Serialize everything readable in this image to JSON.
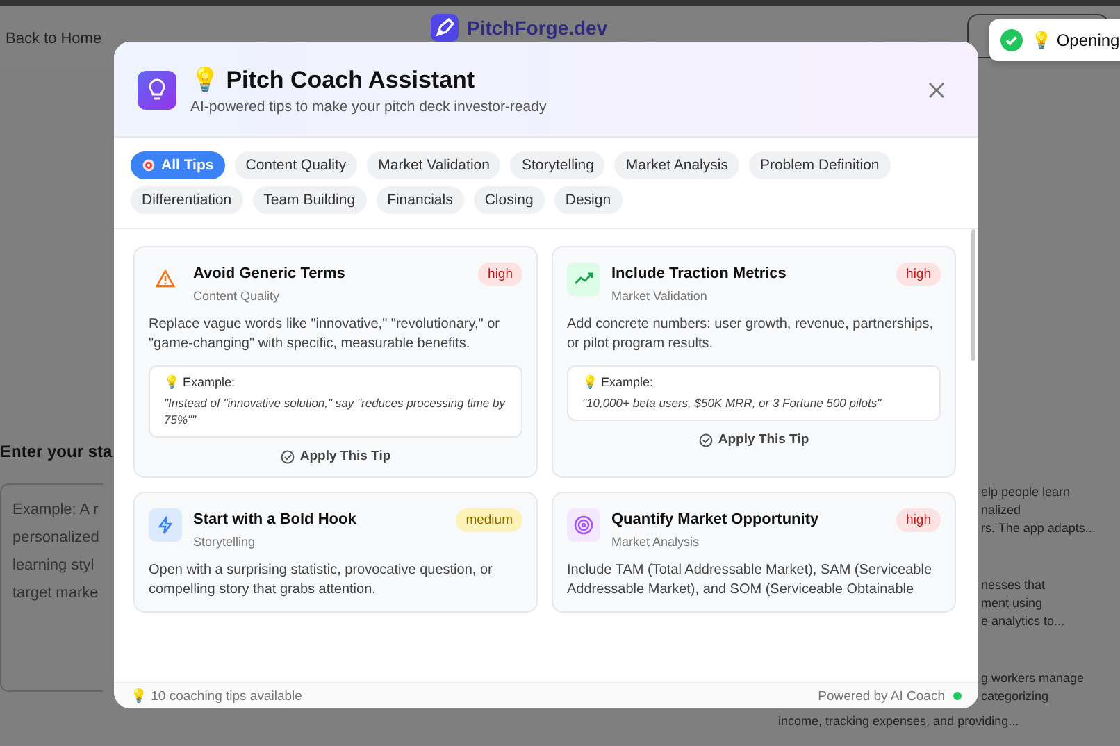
{
  "page": {
    "back_link": "Back to Home",
    "logo_text": "PitchForge.dev",
    "prompt_label": "Enter your sta",
    "textarea_lines": [
      "Example: A r",
      "personalized",
      "learning styl",
      "target marke"
    ],
    "side_cards": [
      [
        "elp people learn",
        "nalized",
        "rs. The app adapts..."
      ],
      [
        "nesses that",
        "ment using",
        "e analytics to..."
      ],
      [
        "g workers manage",
        "categorizing",
        "income, tracking expenses, and providing..."
      ]
    ]
  },
  "toast": {
    "emoji": "💡",
    "text": "Opening"
  },
  "modal": {
    "title_emoji": "💡",
    "title": "Pitch Coach Assistant",
    "subtitle": "AI-powered tips to make your pitch deck investor-ready",
    "filters": [
      {
        "label": "All Tips",
        "selected": true
      },
      {
        "label": "Content Quality",
        "selected": false
      },
      {
        "label": "Market Validation",
        "selected": false
      },
      {
        "label": "Storytelling",
        "selected": false
      },
      {
        "label": "Market Analysis",
        "selected": false
      },
      {
        "label": "Problem Definition",
        "selected": false
      },
      {
        "label": "Differentiation",
        "selected": false
      },
      {
        "label": "Team Building",
        "selected": false
      },
      {
        "label": "Financials",
        "selected": false
      },
      {
        "label": "Closing",
        "selected": false
      },
      {
        "label": "Design",
        "selected": false
      }
    ],
    "tips": [
      {
        "kind": "warning",
        "title": "Avoid Generic Terms",
        "category": "Content Quality",
        "priority": {
          "text": "high",
          "color": "#fde2e2"
        },
        "description": "Replace vague words like \"innovative,\" \"revolutionary,\" or \"game-changing\" with specific, measurable benefits.",
        "example": {
          "emoji": "💡",
          "label": "Example:",
          "text": "\"Instead of \"innovative solution,\" say \"reduces processing time by 75%\"\""
        },
        "action": "Apply This Tip"
      },
      {
        "kind": "trend",
        "title": "Include Traction Metrics",
        "category": "Market Validation",
        "priority": {
          "text": "high",
          "color": "#fde2e2"
        },
        "description": "Add concrete numbers: user growth, revenue, partnerships, or pilot program results.",
        "example": {
          "emoji": "💡",
          "label": "Example:",
          "text": "\"10,000+ beta users, $50K MRR, or 3 Fortune 500 pilots\""
        },
        "action": "Apply This Tip"
      },
      {
        "kind": "bolt",
        "title": "Start with a Bold Hook",
        "category": "Storytelling",
        "priority": {
          "text": "medium",
          "color": "#fdf3b8"
        },
        "description": "Open with a surprising statistic, provocative question, or compelling story that grabs attention."
      },
      {
        "kind": "target",
        "title": "Quantify Market Opportunity",
        "category": "Market Analysis",
        "priority": {
          "text": "high",
          "color": "#fde2e2"
        },
        "description": "Include TAM (Total Addressable Market), SAM (Serviceable Addressable Market), and SOM (Serviceable Obtainable"
      }
    ],
    "footer": {
      "emoji": "💡",
      "count": "10 coaching tips available",
      "powered": "Powered by AI Coach"
    }
  }
}
